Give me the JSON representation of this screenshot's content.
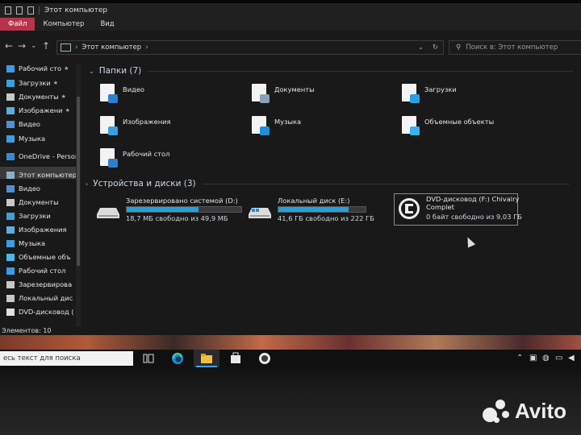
{
  "window": {
    "title": "Этот компьютер"
  },
  "ribbon": {
    "tabs": [
      "Файл",
      "Компьютер",
      "Вид"
    ]
  },
  "address": {
    "path": "Этот компьютер",
    "search_placeholder": "Поиск в: Этот компьютер"
  },
  "sidebar": {
    "items": [
      {
        "label": "Рабочий сто",
        "icon": "desktop-icon",
        "pinned": true
      },
      {
        "label": "Загрузки",
        "icon": "downloads-icon",
        "pinned": true
      },
      {
        "label": "Документы",
        "icon": "documents-icon",
        "pinned": true
      },
      {
        "label": "Изображени",
        "icon": "pictures-icon",
        "pinned": true
      },
      {
        "label": "Видео",
        "icon": "video-icon",
        "pinned": false
      },
      {
        "label": "Музыка",
        "icon": "music-icon",
        "pinned": false
      },
      {
        "label": "OneDrive - Persor",
        "icon": "onedrive-icon",
        "pinned": false
      },
      {
        "label": "Этот компьютер",
        "icon": "computer-icon",
        "pinned": false
      },
      {
        "label": "Видео",
        "icon": "video-icon",
        "pinned": false
      },
      {
        "label": "Документы",
        "icon": "documents-icon",
        "pinned": false
      },
      {
        "label": "Загрузки",
        "icon": "downloads-icon",
        "pinned": false
      },
      {
        "label": "Изображения",
        "icon": "pictures-icon",
        "pinned": false
      },
      {
        "label": "Музыка",
        "icon": "music-icon",
        "pinned": false
      },
      {
        "label": "Объемные объ",
        "icon": "3d-objects-icon",
        "pinned": false
      },
      {
        "label": "Рабочий стол",
        "icon": "desktop-icon",
        "pinned": false
      },
      {
        "label": "Зарезервирова",
        "icon": "drive-icon",
        "pinned": false
      },
      {
        "label": "Локальный дис",
        "icon": "drive-icon",
        "pinned": false
      },
      {
        "label": "DVD-дисковод (",
        "icon": "dvd-icon",
        "pinned": false
      }
    ]
  },
  "folders": {
    "header": "Папки (7)",
    "items": [
      {
        "label": "Видео",
        "badge": "#2f7fd0"
      },
      {
        "label": "Документы",
        "badge": "#8aa0b8"
      },
      {
        "label": "Загрузки",
        "badge": "#2aa0e0"
      },
      {
        "label": "Изображения",
        "badge": "#3aa0e0"
      },
      {
        "label": "Музыка",
        "badge": "#1f8fd8"
      },
      {
        "label": "Объемные объекты",
        "badge": "#3ab0e8"
      },
      {
        "label": "Рабочий стол",
        "badge": "#2f80c8"
      }
    ]
  },
  "drives": {
    "header": "Устройства и диски (3)",
    "items": [
      {
        "name": "Зарезервировано системой (D:)",
        "free": "18,7 МБ свободно из 49,9 МБ",
        "used_fraction": 0.63
      },
      {
        "name": "Локальный диск (E:)",
        "free": "41,6 ГБ свободно из 222 ГБ",
        "used_fraction": 0.81
      },
      {
        "name": "DVD-дисковод (F:) Chivalry",
        "name2": "Complet",
        "free": "0 байт свободно из 9,03 ГБ"
      }
    ]
  },
  "status": {
    "count": "Элементов: 10"
  },
  "taskbar": {
    "search_placeholder": "есь текст для поиска"
  },
  "watermark": {
    "text": "Avito"
  }
}
